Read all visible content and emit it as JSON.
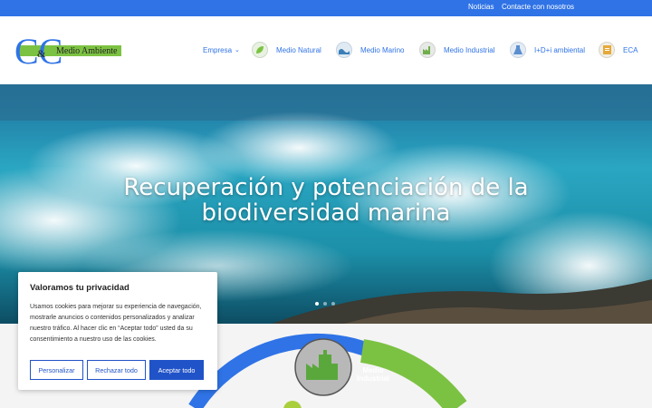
{
  "topbar": {
    "links": [
      "Noticias",
      "Contacte con nosotros"
    ]
  },
  "logo": {
    "letters": "CC",
    "amp": "&",
    "text": "Medio Ambiente"
  },
  "nav": {
    "empresa": "Empresa",
    "items": [
      "Medio Natural",
      "Medio Marino",
      "Medio Industrial",
      "I+D+i ambiental",
      "ECA"
    ]
  },
  "hero": {
    "title_line1": "Recuperación y potenciación de la",
    "title_line2": "biodiversidad marina"
  },
  "diagram": {
    "label_line1": "Medio",
    "label_line2": "Industrial"
  },
  "cookie": {
    "title": "Valoramos tu privacidad",
    "body": "Usamos cookies para mejorar su experiencia de navegación, mostrarle anuncios o contenidos personalizados y analizar nuestro tráfico. Al hacer clic en “Aceptar todo” usted da su consentimiento a nuestro uso de las cookies.",
    "btn_customize": "Personalizar",
    "btn_reject": "Rechazar todo",
    "btn_accept": "Aceptar todo"
  },
  "colors": {
    "brand_blue": "#2f73e6",
    "accent_green": "#7cc242",
    "button_blue": "#2153c8"
  }
}
